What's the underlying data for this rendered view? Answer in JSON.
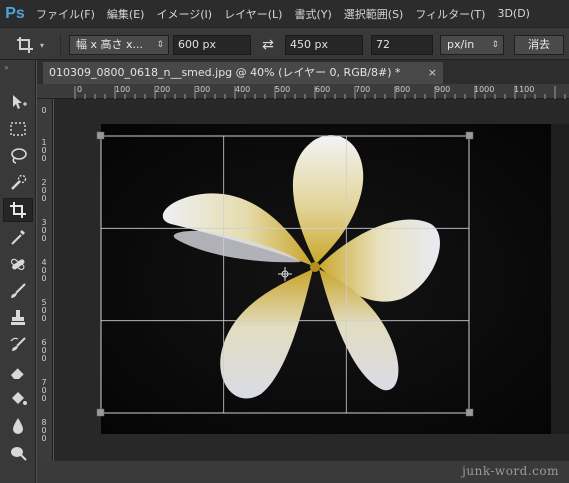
{
  "app": {
    "logo": "Ps"
  },
  "menu": [
    "ファイル(F)",
    "編集(E)",
    "イメージ(I)",
    "レイヤー(L)",
    "書式(Y)",
    "選択範囲(S)",
    "フィルター(T)",
    "3D(D)"
  ],
  "options": {
    "tool_icon": "crop-icon",
    "preset": "幅 x 高さ x...",
    "width": "600 px",
    "swap_icon": "swap-arrows-icon",
    "height": "450 px",
    "resolution": "72",
    "resolution_unit": "px/in",
    "clear_button": "消去"
  },
  "document": {
    "tab_title": "010309_0800_0618_n__smed.jpg @ 40% (レイヤー 0, RGB/8#) *",
    "close_glyph": "×"
  },
  "rulers": {
    "horizontal": [
      "0",
      "100",
      "200",
      "300",
      "400",
      "500",
      "600",
      "700",
      "800",
      "900",
      "1000",
      "1100"
    ],
    "vertical": [
      "0",
      "1 0 0",
      "2 0 0",
      "3 0 0",
      "4 0 0",
      "5 0 0",
      "6 0 0",
      "7 0 0",
      "8 0 0"
    ]
  },
  "tools": [
    "move-icon",
    "marquee-icon",
    "lasso-icon",
    "quick-select-icon",
    "crop-icon",
    "eyedropper-icon",
    "healing-icon",
    "brush-icon",
    "stamp-icon",
    "history-brush-icon",
    "eraser-icon",
    "paint-bucket-icon",
    "blur-icon",
    "dodge-icon"
  ],
  "active_tool": "crop-icon",
  "watermark": "junk-word.com"
}
